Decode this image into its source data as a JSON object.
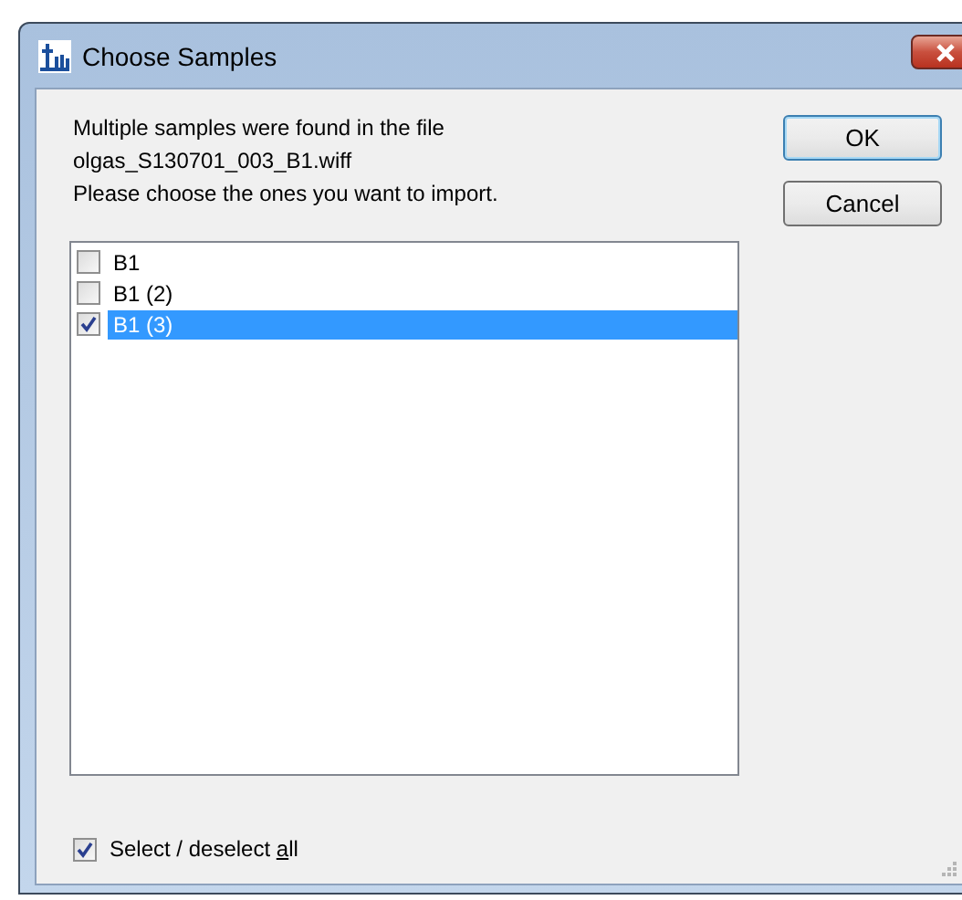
{
  "window": {
    "title": "Choose Samples"
  },
  "message": [
    "Multiple samples were found in the file",
    "olgas_S130701_003_B1.wiff",
    "Please choose the ones you want to import."
  ],
  "samples": [
    {
      "label": "B1",
      "checked": false,
      "selected": false
    },
    {
      "label": "B1 (2)",
      "checked": false,
      "selected": false
    },
    {
      "label": "B1 (3)",
      "checked": true,
      "selected": true
    }
  ],
  "buttons": [
    {
      "label": "OK",
      "kind": "default"
    },
    {
      "label": "Cancel",
      "kind": "normal"
    }
  ],
  "select_all": {
    "before": "Select / deselect ",
    "mnemonic": "a",
    "after": "ll",
    "checked": true
  }
}
